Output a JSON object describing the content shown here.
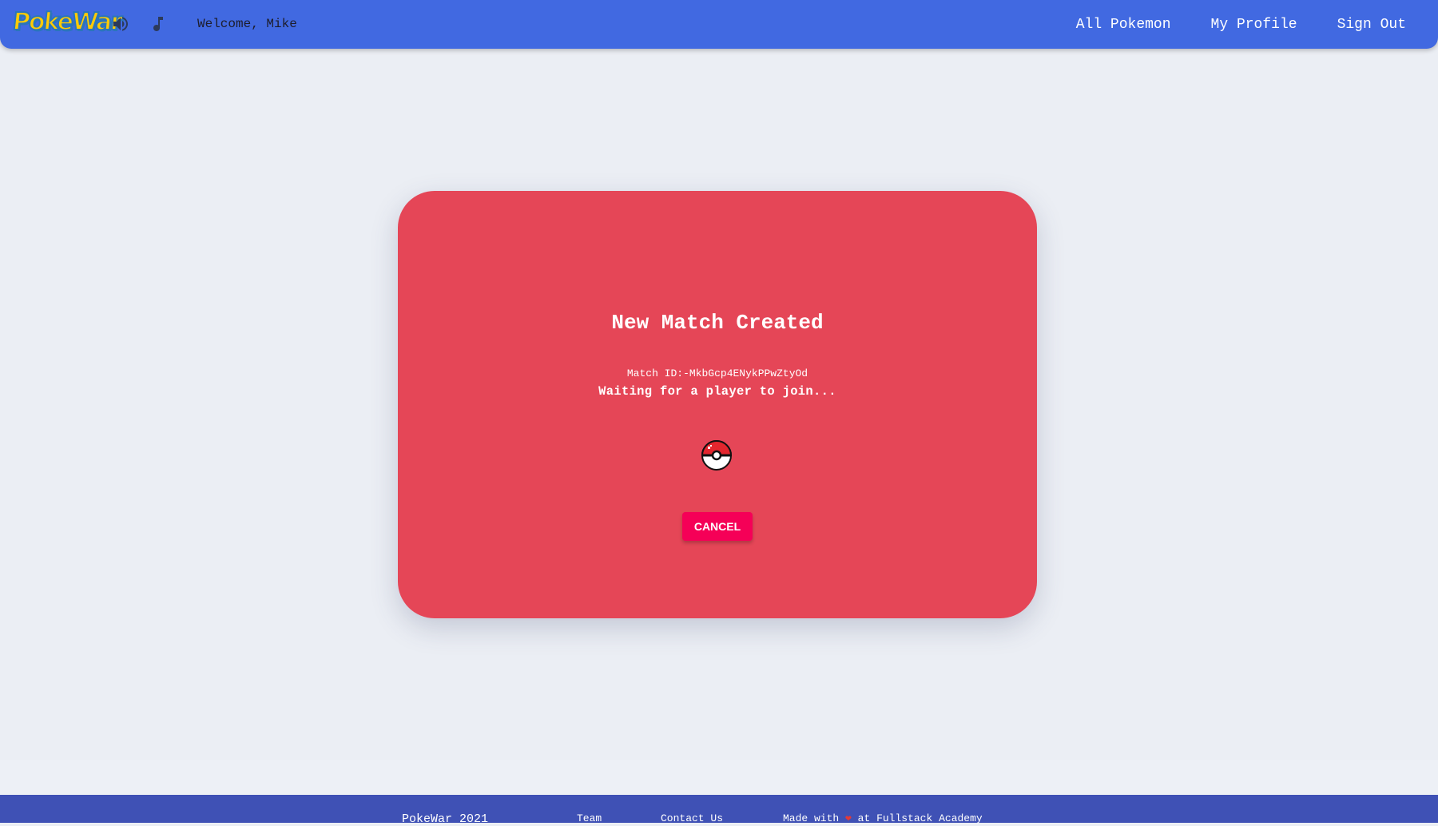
{
  "header": {
    "logo_text": "PokeWar",
    "icons": [
      "volume-icon",
      "music-note-icon"
    ],
    "welcome": "Welcome, Mike",
    "links": [
      "All Pokemon",
      "My Profile",
      "Sign Out"
    ],
    "colors": {
      "navbar": "#4169e1",
      "logo_yellow": "#ffcb05",
      "logo_blue": "#2a75bb"
    }
  },
  "card": {
    "title": "New Match Created",
    "match_id": "Match ID:-MkbGcp4ENykPPwZtyOd",
    "status": "Waiting for a player to join...",
    "cancel_label": "CANCEL",
    "colors": {
      "card": "#e54657",
      "cancel": "#f50057"
    }
  },
  "footer": {
    "brand": "PokeWar 2021",
    "team": "Team",
    "contact": "Contact Us",
    "made_prefix": "Made with",
    "made_suffix": "at Fullstack Academy",
    "colors": {
      "footer": "#3f51b5"
    }
  }
}
